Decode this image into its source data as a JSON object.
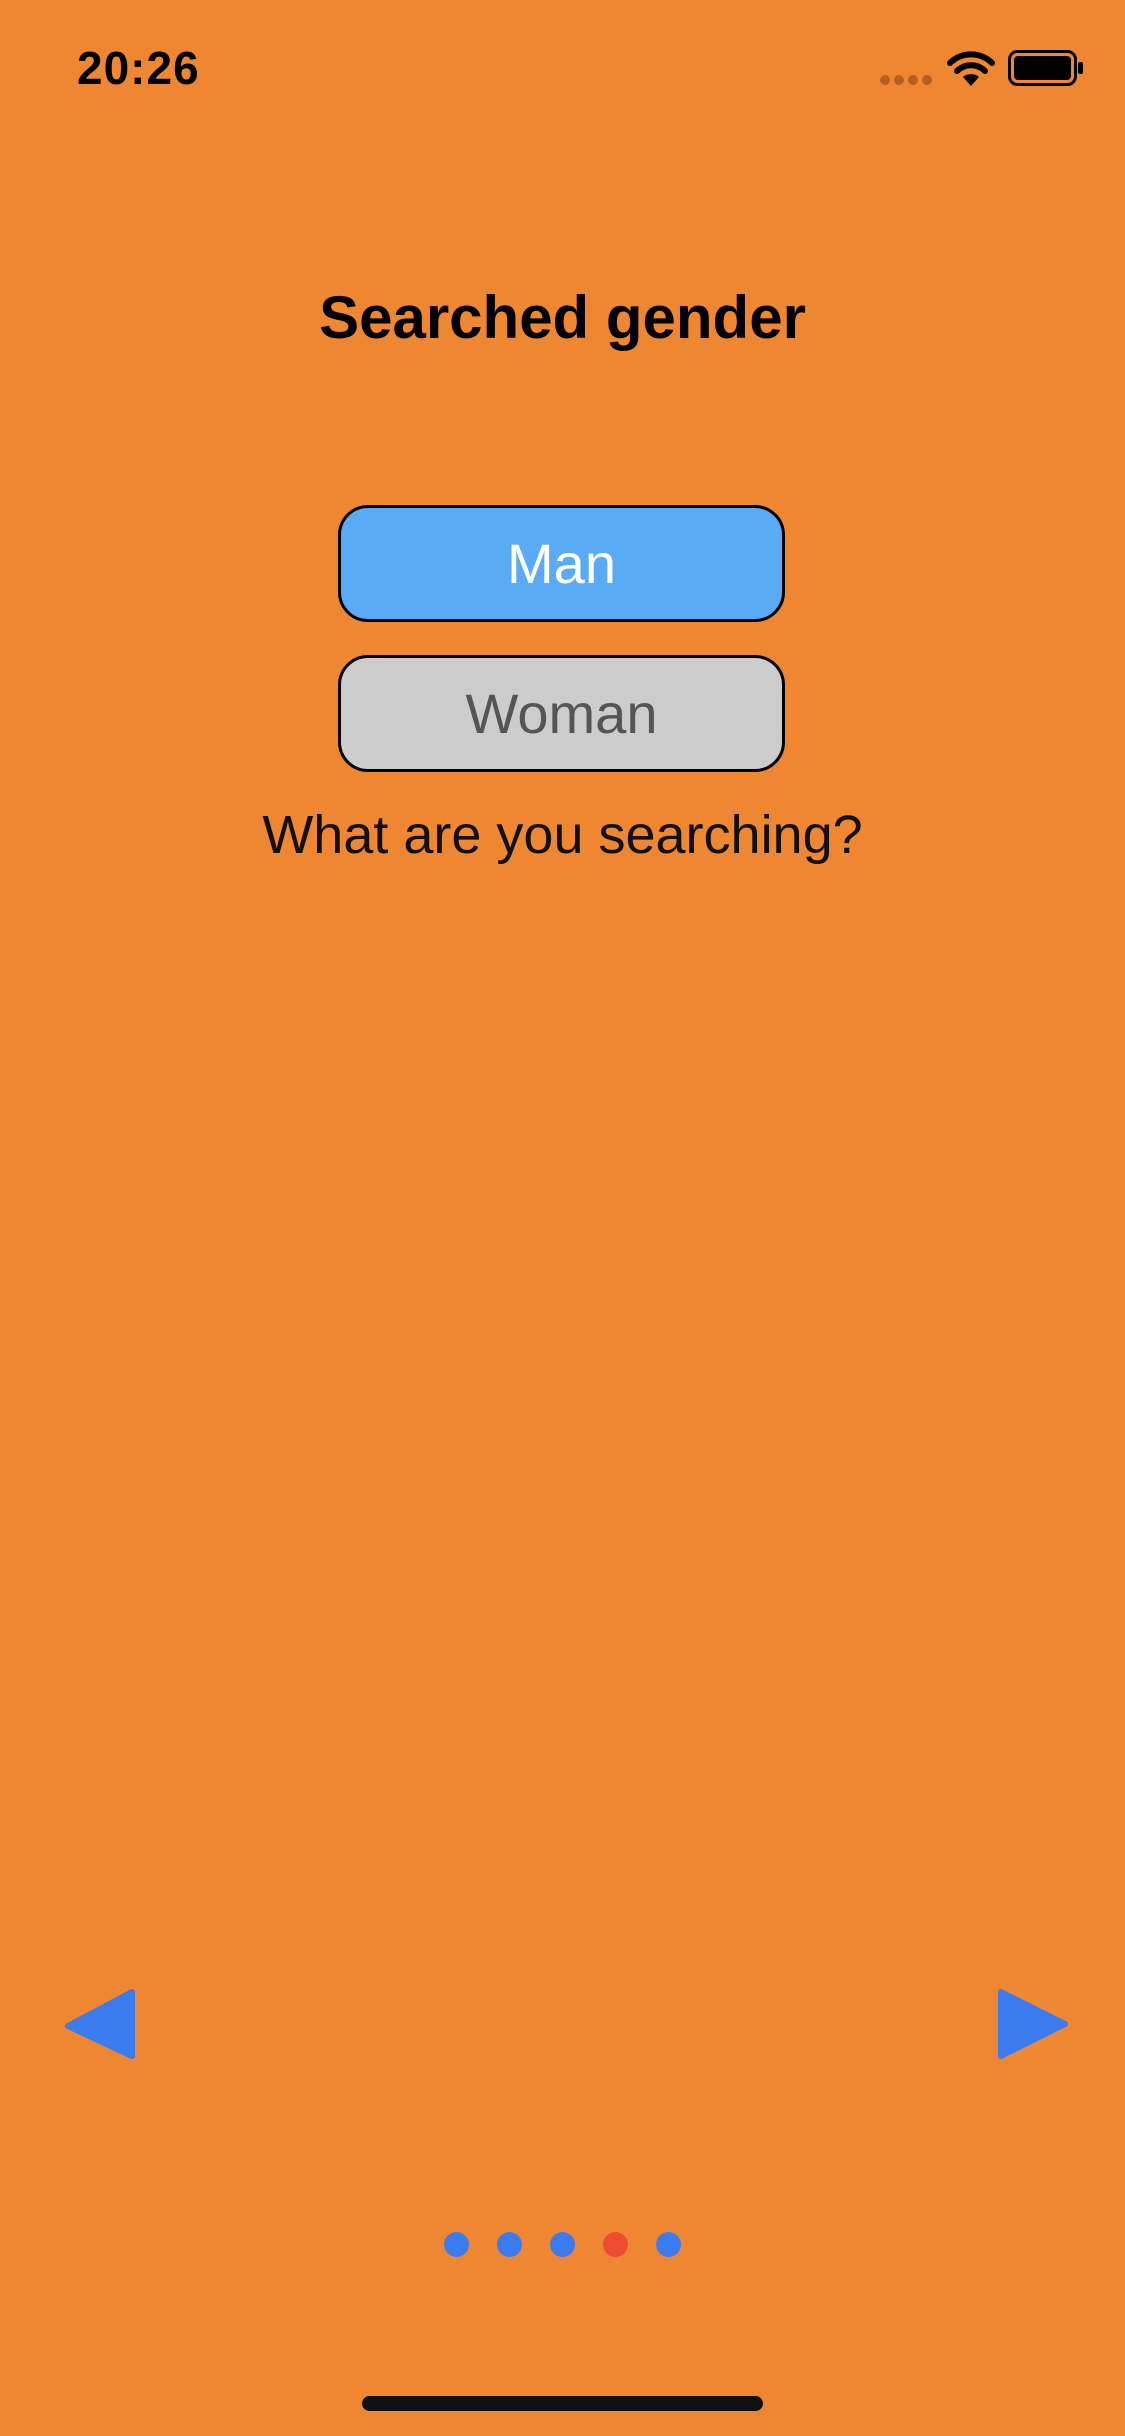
{
  "status_bar": {
    "time": "20:26"
  },
  "screen": {
    "title": "Searched gender",
    "prompt": "What are you searching?"
  },
  "options": [
    {
      "label": "Man",
      "selected": true
    },
    {
      "label": "Woman",
      "selected": false
    }
  ],
  "navigation": {
    "prev_icon": "triangle-left-icon",
    "next_icon": "triangle-right-icon"
  },
  "pagination": {
    "total_pages": 5,
    "current_page": 4
  },
  "colors": {
    "background": "#EF8732",
    "selected_option": "#5AABF5",
    "unselected_option": "#CCCCCC",
    "nav_arrow": "#3B7BF0",
    "dot_inactive": "#3B7BF0",
    "dot_active": "#EE4D32"
  }
}
